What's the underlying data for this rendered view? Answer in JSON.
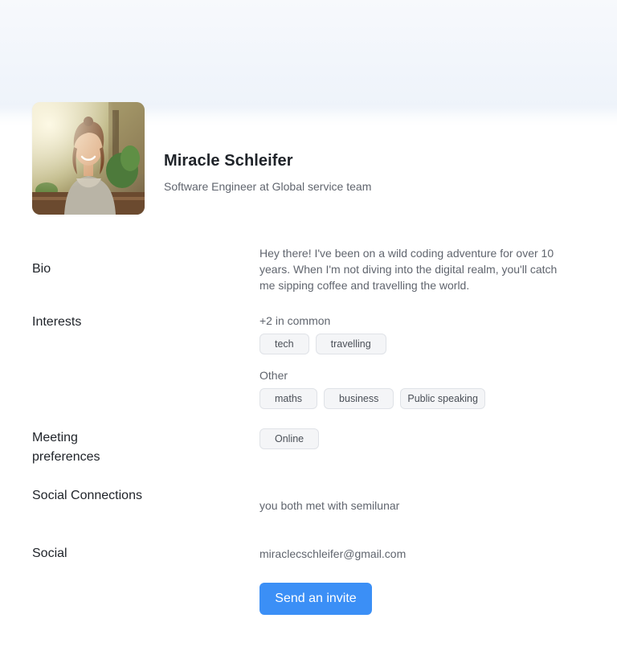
{
  "profile": {
    "name": "Miracle Schleifer",
    "title": "Software Engineer at Global service team"
  },
  "bio": {
    "label": "Bio",
    "text": "Hey there! I've been on a wild coding adventure for over 10 years. When I'm not diving into the digital realm, you'll catch me sipping coffee and travelling the world."
  },
  "interests": {
    "label": "Interests",
    "common_label": "+2 in common",
    "common": [
      "tech",
      "travelling"
    ],
    "other_label": "Other",
    "other": [
      "maths",
      "business",
      "Public speaking"
    ]
  },
  "meeting": {
    "label": "Meeting preferences",
    "options": [
      "Online"
    ]
  },
  "social_connections": {
    "label": "Social Connections",
    "text": "you both met with semilunar"
  },
  "social": {
    "label": "Social",
    "email": "miraclecschleifer@gmail.com"
  },
  "actions": {
    "invite_label": "Send an invite"
  },
  "colors": {
    "accent": "#3b8ff6",
    "chip_bg": "#f4f5f7",
    "chip_border": "#dfe2e7",
    "muted_text": "#60656e"
  }
}
